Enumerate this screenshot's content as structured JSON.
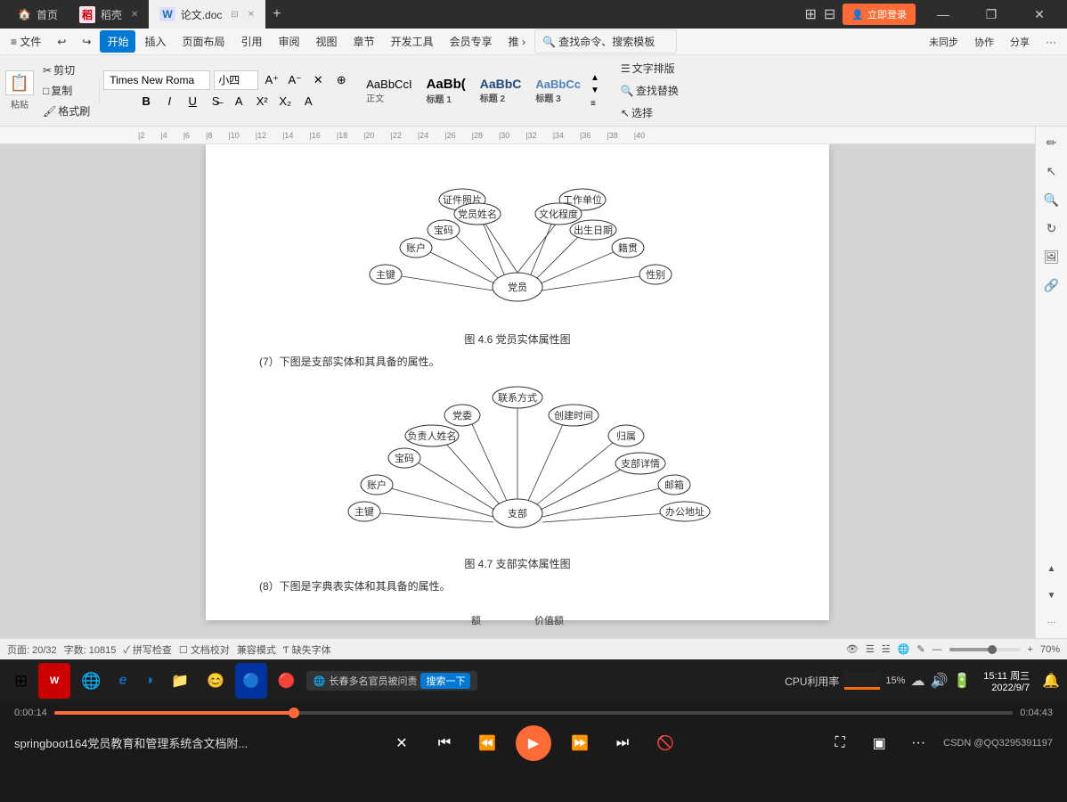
{
  "titleBar": {
    "tabs": [
      {
        "id": "home",
        "label": "首页",
        "active": false,
        "icon": "🏠"
      },
      {
        "id": "daoke",
        "label": "稻壳",
        "active": false,
        "icon": "📄",
        "closable": true
      },
      {
        "id": "doc",
        "label": "论文.doc",
        "active": true,
        "icon": "📝",
        "closable": true
      }
    ],
    "addTab": "+",
    "windowControls": {
      "grid": "⊞",
      "apps": "⊟",
      "login": "立即登录",
      "minimize": "—",
      "restore": "❐",
      "close": "✕"
    }
  },
  "menuBar": {
    "items": [
      {
        "id": "file",
        "label": "≡ 文件"
      },
      {
        "id": "undo",
        "label": "↩"
      },
      {
        "id": "redo",
        "label": "↪"
      },
      {
        "id": "home",
        "label": "开始",
        "active": true
      },
      {
        "id": "insert",
        "label": "插入"
      },
      {
        "id": "layout",
        "label": "页面布局"
      },
      {
        "id": "ref",
        "label": "引用"
      },
      {
        "id": "review",
        "label": "审阅"
      },
      {
        "id": "view",
        "label": "视图"
      },
      {
        "id": "chapter",
        "label": "章节"
      },
      {
        "id": "dev",
        "label": "开发工具"
      },
      {
        "id": "member",
        "label": "会员专享"
      },
      {
        "id": "push",
        "label": "推 ›"
      },
      {
        "id": "search",
        "label": "🔍 查找命令、搜索模板"
      }
    ],
    "rightItems": [
      {
        "id": "sync",
        "label": "≠ 未同步"
      },
      {
        "id": "collab",
        "label": "ⓔ 协作"
      },
      {
        "id": "share",
        "label": "⊹ 分享"
      },
      {
        "id": "more",
        "label": "···"
      }
    ]
  },
  "ribbon": {
    "pasteGroup": {
      "paste": "粘贴",
      "cut": "✂ 剪切",
      "copy": "□ 复制",
      "formatPaint": "格式刷"
    },
    "fontGroup": {
      "fontName": "Times New Roma",
      "fontSize": "小四",
      "boldLabel": "B",
      "italicLabel": "I",
      "underlineLabel": "U"
    },
    "styles": [
      {
        "id": "normal",
        "label": "正文",
        "class": "normal"
      },
      {
        "id": "h1",
        "label": "标题 1",
        "class": "h1"
      },
      {
        "id": "h2",
        "label": "标题 2",
        "class": "h2"
      },
      {
        "id": "h3",
        "label": "标题 3",
        "class": "h3"
      }
    ],
    "textLayout": "文字排版",
    "findReplace": "查找替换",
    "select": "选择"
  },
  "document": {
    "diagrams": [
      {
        "id": "fig46",
        "caption": "图 4.6 党员实体属性图",
        "centerNode": "党员",
        "attributes": [
          "证件照片",
          "工作单位",
          "党员姓名",
          "文化程度",
          "宝码",
          "出生日期",
          "账户",
          "籍贯",
          "主键",
          "性别"
        ]
      },
      {
        "id": "fig47",
        "caption": "图 4.7 支部实体属性图",
        "centerNode": "支部",
        "attributes": [
          "联系方式",
          "党委",
          "创建时间",
          "负责人姓名",
          "归属",
          "宝码",
          "支部详情",
          "账户",
          "邮箱",
          "主键",
          "办公地址"
        ]
      }
    ],
    "paragraphs": [
      "(7）下图是支部实体和其具备的属性。",
      "(8）下图是字典表实体和其具备的属性。"
    ]
  },
  "statusBar": {
    "pageInfo": "页面: 20/32",
    "wordCount": "字数: 10815",
    "spell": "✓ 拼写检查",
    "docCompare": "☐ 文档校对",
    "compatMode": "兼容模式",
    "missingFont": "Ƭ 缺失字体",
    "zoom": "70%",
    "zoomControls": "— ○ +"
  },
  "taskbar": {
    "startIcon": "⊞",
    "items": [
      {
        "id": "wps",
        "icon": "📄",
        "color": "#c00"
      },
      {
        "id": "browser",
        "icon": "🌐"
      },
      {
        "id": "ie",
        "icon": "e"
      },
      {
        "id": "edge",
        "icon": "◑"
      },
      {
        "id": "folder",
        "icon": "📁"
      },
      {
        "id": "emoji",
        "icon": "😊"
      },
      {
        "id": "app1",
        "icon": "🔵"
      },
      {
        "id": "app2",
        "icon": "🔴"
      }
    ],
    "tray": {
      "network": "📶",
      "speaker": "🔊",
      "time": "15:11 周三",
      "date": "2022/9/7"
    },
    "systemNotif": "长春多名官员被问责"
  },
  "videoPlayer": {
    "title": "springboot164党员教育和管理系统含文档附...",
    "currentTime": "0:00:14",
    "totalTime": "0:04:43",
    "progress": 25,
    "controls": {
      "noKill": "✕",
      "prev": "⏮",
      "back10": "⏪",
      "play": "▶",
      "fwd": "⏩",
      "next": "⏭",
      "noVideo": "🚫"
    },
    "csdn": "CSDN @QQ3295391197"
  }
}
